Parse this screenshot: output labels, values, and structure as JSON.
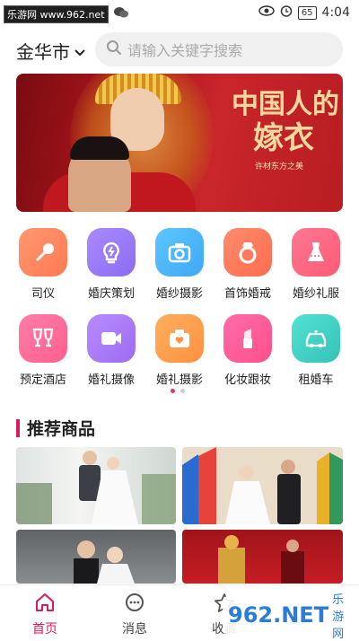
{
  "status_bar": {
    "watermark": "乐游网 www.962.net",
    "battery": "65",
    "time": "4:04"
  },
  "header": {
    "city": "金华市",
    "search_placeholder": "请输入关键字搜索"
  },
  "banner": {
    "title_line1": "中国人的",
    "title_line2": "嫁衣",
    "subtitle": "许材东方之美",
    "dot_count": 3,
    "active_dot": 1
  },
  "categories": [
    {
      "label": "司仪",
      "icon": "microphone-icon",
      "color": "#ff7a52"
    },
    {
      "label": "婚庆策划",
      "icon": "lightbulb-icon",
      "color": "#8b6cf0"
    },
    {
      "label": "婚纱摄影",
      "icon": "camera-icon",
      "color": "#3fa8f5"
    },
    {
      "label": "首饰婚戒",
      "icon": "ring-icon",
      "color": "#ff6d4f"
    },
    {
      "label": "婚纱礼服",
      "icon": "dress-icon",
      "color": "#ff5a74"
    },
    {
      "label": "预定酒店",
      "icon": "wine-glasses-icon",
      "color": "#ff5f8c"
    },
    {
      "label": "婚礼摄像",
      "icon": "video-camera-icon",
      "color": "#9b6df2"
    },
    {
      "label": "婚礼摄影",
      "icon": "heart-camera-icon",
      "color": "#ff9140"
    },
    {
      "label": "化妆跟妆",
      "icon": "lipstick-icon",
      "color": "#ff4f8b"
    },
    {
      "label": "租婚车",
      "icon": "car-icon",
      "color": "#35c3b6"
    }
  ],
  "section": {
    "title": "推荐商品"
  },
  "tabbar": [
    {
      "label": "首页",
      "icon": "home-icon",
      "active": true
    },
    {
      "label": "消息",
      "icon": "chat-icon",
      "active": false
    },
    {
      "label": "收藏",
      "icon": "star-icon",
      "active": false
    }
  ],
  "corner_watermark": {
    "number": "962.NET",
    "text": "乐游网"
  }
}
